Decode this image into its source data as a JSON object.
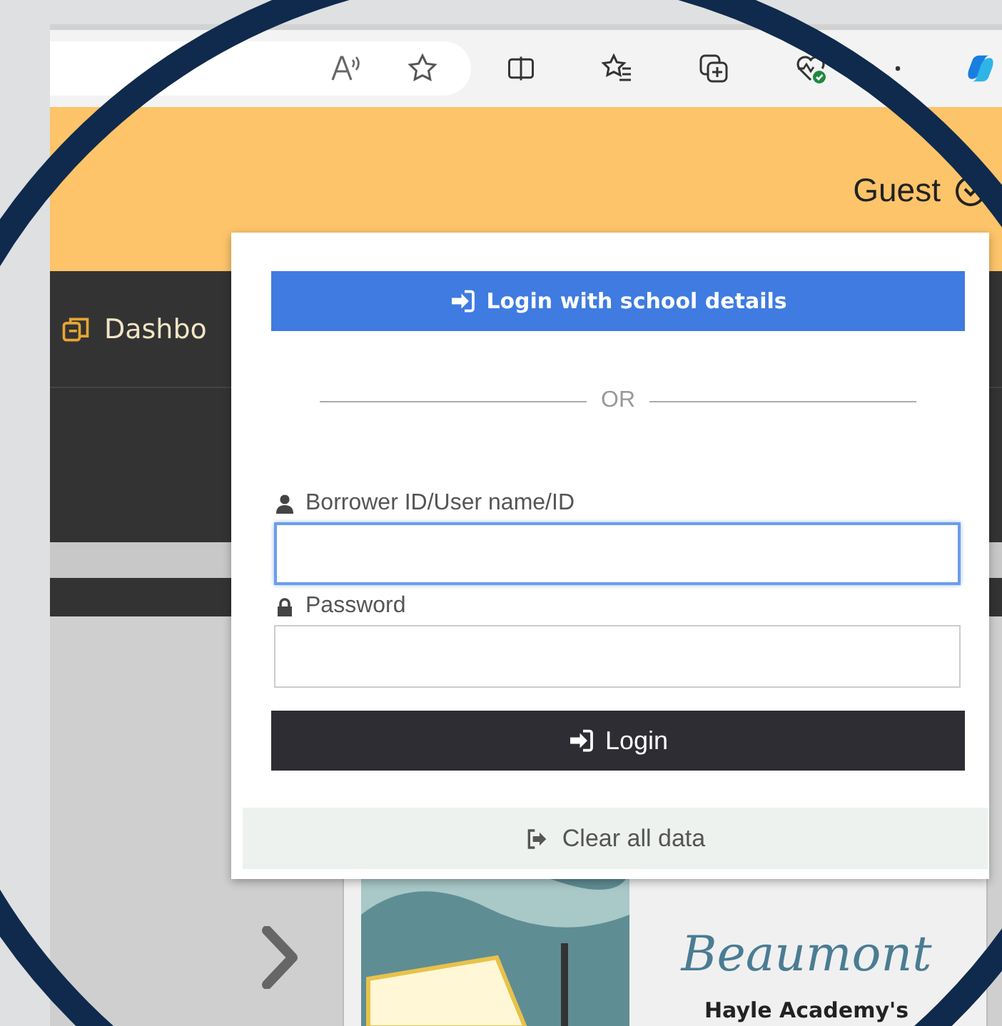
{
  "header": {
    "user_menu": "Guest"
  },
  "nav": {
    "items": [
      {
        "label": "Dashbo"
      }
    ]
  },
  "login_dropdown": {
    "school_login_button": "Login with school details",
    "divider_text": "OR",
    "fields": [
      {
        "label": "Borrower ID/User name/ID",
        "kind": "user",
        "focused": true
      },
      {
        "label": "Password",
        "kind": "lock",
        "focused": false
      }
    ],
    "login_button": "Login",
    "clear_button": "Clear all data"
  },
  "featured_book": {
    "title": "Beaumont",
    "subtitle": "Hayle Academy's",
    "kind": "picture"
  }
}
